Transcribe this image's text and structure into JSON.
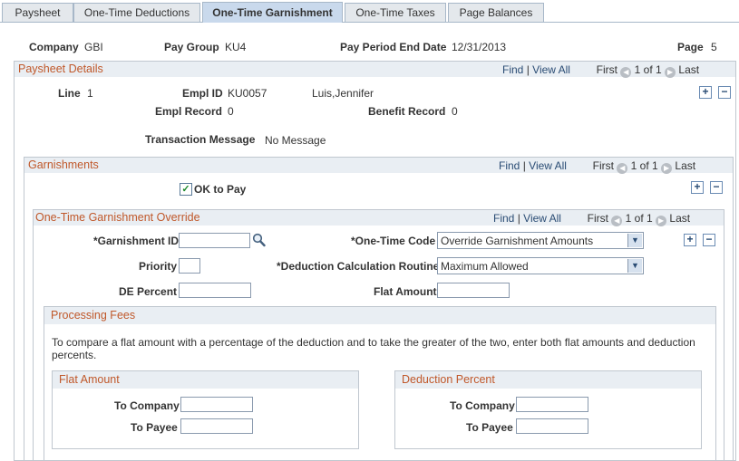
{
  "tabs": [
    {
      "label": "Paysheet"
    },
    {
      "label": "One-Time Deductions"
    },
    {
      "label": "One-Time Garnishment"
    },
    {
      "label": "One-Time Taxes"
    },
    {
      "label": "Page Balances"
    }
  ],
  "header": {
    "company_label": "Company",
    "company_value": "GBI",
    "paygroup_label": "Pay Group",
    "paygroup_value": "KU4",
    "period_label": "Pay Period End Date",
    "period_value": "12/31/2013",
    "page_label": "Page",
    "page_value": "5"
  },
  "paysheet": {
    "title": "Paysheet Details",
    "find": "Find",
    "sep": "|",
    "view_all": "View All",
    "first": "First",
    "count": "1 of 1",
    "last": "Last",
    "line_label": "Line",
    "line_value": "1",
    "emplid_label": "Empl ID",
    "emplid_value": "KU0057",
    "name_value": "Luis,Jennifer",
    "emplrec_label": "Empl Record",
    "emplrec_value": "0",
    "benrec_label": "Benefit Record",
    "benrec_value": "0",
    "txmsg_label": "Transaction Message",
    "txmsg_value": "No Message"
  },
  "garnishments": {
    "title": "Garnishments",
    "find": "Find",
    "sep": "|",
    "view_all": "View All",
    "first": "First",
    "count": "1 of 1",
    "last": "Last",
    "ok_to_pay_label": "OK to Pay",
    "ok_to_pay_checked": true
  },
  "override": {
    "title": "One-Time Garnishment Override",
    "find": "Find",
    "sep": "|",
    "view_all": "View All",
    "first": "First",
    "count": "1 of 1",
    "last": "Last",
    "garn_id_label": "*Garnishment ID",
    "garn_id_value": "",
    "priority_label": "Priority",
    "priority_value": "",
    "de_percent_label": "DE Percent",
    "de_percent_value": "",
    "onetime_code_label": "*One-Time Code",
    "onetime_code_value": "Override Garnishment Amounts",
    "calc_routine_label": "*Deduction Calculation Routine",
    "calc_routine_value": "Maximum Allowed",
    "flat_amount_label": "Flat Amount",
    "flat_amount_value": ""
  },
  "fees": {
    "title": "Processing Fees",
    "instructions": "To compare a flat amount with a percentage of the deduction and to take the greater of the two, enter both flat amounts and deduction percents.",
    "flat": {
      "title": "Flat Amount",
      "to_company_label": "To Company",
      "to_payee_label": "To Payee",
      "to_company_value": "",
      "to_payee_value": ""
    },
    "pct": {
      "title": "Deduction Percent",
      "to_company_label": "To Company",
      "to_payee_label": "To Payee",
      "to_company_value": "",
      "to_payee_value": ""
    }
  },
  "icons": {
    "prev": "◀",
    "next": "▶",
    "plus": "+",
    "minus": "−",
    "lookup": "magnifier-icon",
    "check": "✓",
    "dropdown": "▼"
  },
  "colors": {
    "group_title": "#c0582a",
    "link": "#2a4c74",
    "header_band": "#e9eef3",
    "active_tab": "#c9d9ec"
  }
}
